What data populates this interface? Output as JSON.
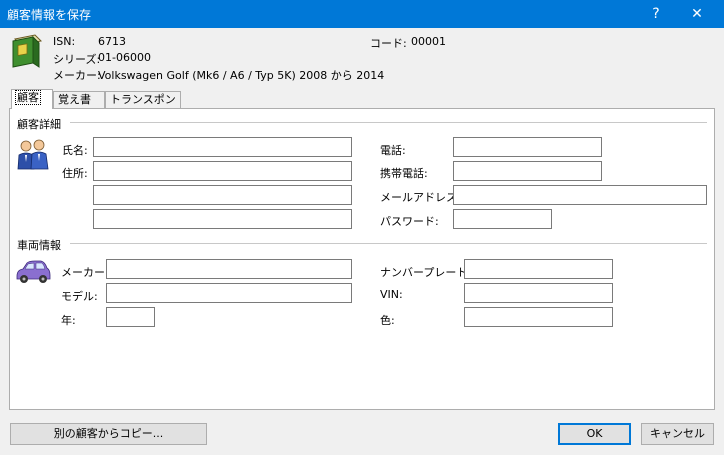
{
  "window": {
    "title": "顧客情報を保存",
    "help_label": "?",
    "close_label": "✕"
  },
  "header": {
    "isn_label": "ISN:",
    "isn_value": "6713",
    "series_label": "シリーズ:",
    "series_value": "01-06000",
    "maker_label": "メーカー:",
    "maker_value": "Volkswagen Golf (Mk6 / A6 / Typ 5K) 2008 から 2014",
    "code_label": "コード:",
    "code_value": "00001"
  },
  "tabs": [
    {
      "label": "顧客",
      "active": true
    },
    {
      "label": "覚え書き",
      "active": false
    },
    {
      "label": "トランスポンダ",
      "active": false
    }
  ],
  "customer": {
    "section_title": "顧客詳細",
    "name_label": "氏名:",
    "name_value": "",
    "address_label": "住所:",
    "address1": "",
    "address2": "",
    "address3": "",
    "phone_label": "電話:",
    "phone_value": "",
    "mobile_label": "携帯電話:",
    "mobile_value": "",
    "email_label": "メールアドレス:",
    "email_value": "",
    "password_label": "パスワード:",
    "password_value": ""
  },
  "vehicle": {
    "section_title": "車両情報",
    "maker_label": "メーカー:",
    "maker_value": "",
    "model_label": "モデル:",
    "model_value": "",
    "year_label": "年:",
    "year_value": "",
    "plate_label": "ナンバープレート:",
    "plate_value": "",
    "vin_label": "VIN:",
    "vin_value": "",
    "color_label": "色:",
    "color_value": ""
  },
  "footer": {
    "copy_button": "別の顧客からコピー...",
    "ok_button": "OK",
    "cancel_button": "キャンセル"
  },
  "icons": {
    "book": "green-book-icon",
    "customer": "people-icon",
    "vehicle": "car-icon"
  },
  "colors": {
    "titlebar": "#0078d7",
    "accent": "#0078d7"
  }
}
